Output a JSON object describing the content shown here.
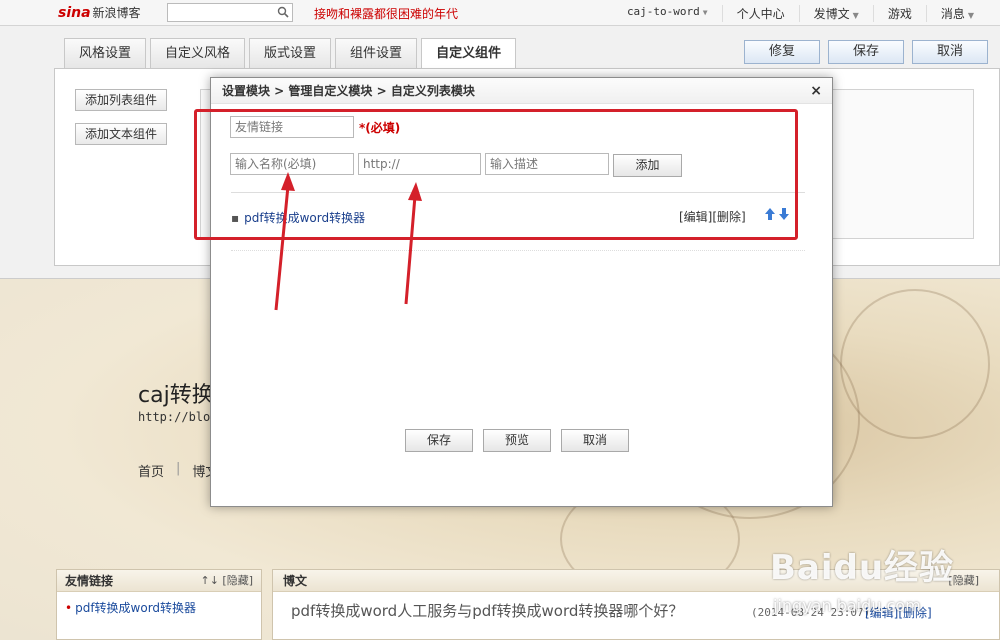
{
  "topbar": {
    "logo": "sina",
    "logo_sub": "新浪博客",
    "search_placeholder": "",
    "headline": "接吻和裸露都很困难的年代",
    "nav": [
      "caj-to-word",
      "个人中心",
      "发博文",
      "游戏",
      "消息"
    ]
  },
  "settings": {
    "tabs": [
      "风格设置",
      "自定义风格",
      "版式设置",
      "组件设置",
      "自定义组件"
    ],
    "active_tab": "自定义组件",
    "actions": [
      "修复",
      "保存",
      "取消"
    ],
    "side_buttons": [
      "添加列表组件",
      "添加文本组件"
    ]
  },
  "modal": {
    "breadcrumb": "设置模块 > 管理自定义模块 > 自定义列表模块",
    "close_label": "×",
    "title_value": "友情链接",
    "required_note": "*(必填)",
    "name_placeholder": "输入名称(必填)",
    "url_value": "http://",
    "desc_placeholder": "输入描述",
    "add_label": "添加",
    "list_item": "pdf转换成word转换器",
    "item_ops": "[编辑][删除]",
    "footer_buttons": [
      "保存",
      "预览",
      "取消"
    ]
  },
  "blog": {
    "title": "caj转换",
    "url": "http://blog.s",
    "nav": [
      "首页",
      "博文"
    ],
    "widget_title": "友情链接",
    "widget_ops": "↑↓ [隐藏]",
    "widget_link": "pdf转换成word转换器",
    "post_section": "博文",
    "post_ops_head": "[隐藏]",
    "post_title": "pdf转换成word人工服务与pdf转换成word转换器哪个好？",
    "post_time": "(2014-08-24 23:07)",
    "post_ops": "[编辑][删除]"
  },
  "watermark": {
    "brand": "Baidu经验",
    "url": "jingyan.baidu.com"
  },
  "colors": {
    "accent_red": "#d4202a",
    "link_blue": "#1a3f8c"
  }
}
